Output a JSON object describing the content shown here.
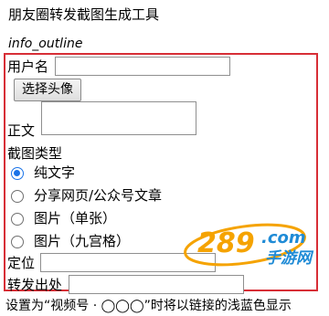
{
  "page_title": "朋友圈转发截图生成工具",
  "info_icon_name": "info_outline",
  "form": {
    "username_label": "用户名",
    "avatar_button": "选择头像",
    "body_label": "正文",
    "screenshot_type_label": "截图类型",
    "types": [
      {
        "label": "纯文字",
        "checked": true
      },
      {
        "label": "分享网页/公众号文章",
        "checked": false
      },
      {
        "label": "图片（单张）",
        "checked": false
      },
      {
        "label": "图片（九宫格）",
        "checked": false
      }
    ],
    "location_label": "定位",
    "forward_source_label": "转发出处"
  },
  "footer_note": "设置为“视频号 · ◯◯◯”时将以链接的浅蓝色显示",
  "watermark": {
    "number": "289",
    "com": ".com",
    "brand": "手游网"
  },
  "colors": {
    "frame": "#d72e36",
    "radio": "#1a73e8",
    "watermark_orange": "#f5a300",
    "watermark_blue": "#1f8bd6"
  }
}
